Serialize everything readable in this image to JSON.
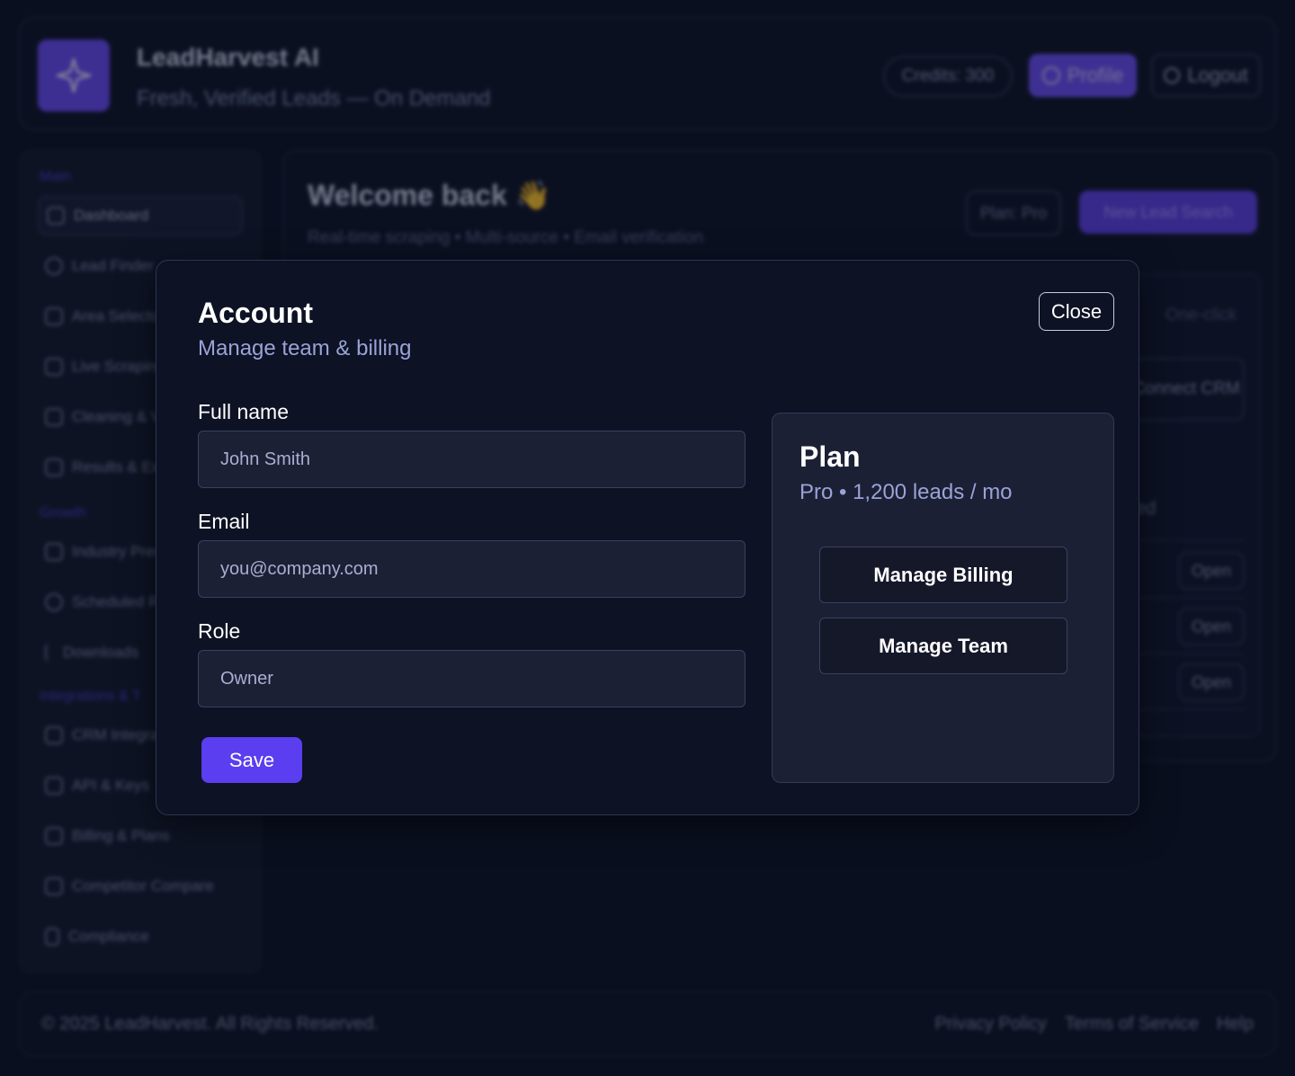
{
  "header": {
    "brand_title": "LeadHarvest AI",
    "brand_subtitle": "Fresh, Verified Leads — On Demand",
    "credits": "Credits: 300",
    "profile_label": "Profile",
    "logout_label": "Logout",
    "logo_icon": "sparkle-icon"
  },
  "sidebar": {
    "sections": [
      "Main",
      "Growth",
      "Integrations & T"
    ],
    "items": [
      {
        "label": "Dashboard",
        "icon": "home-icon"
      },
      {
        "label": "Lead Finder",
        "icon": "search-icon"
      },
      {
        "label": "Area Selector",
        "icon": "map-icon"
      },
      {
        "label": "Live Scraping",
        "icon": "broom-icon"
      },
      {
        "label": "Cleaning & Verification",
        "icon": "calendar-icon"
      },
      {
        "label": "Results & Exports",
        "icon": "file-icon"
      },
      {
        "label": "Industry Presets",
        "icon": "folder-icon"
      },
      {
        "label": "Scheduled Runs",
        "icon": "clock-icon"
      },
      {
        "label": "Downloads",
        "icon": "download-icon"
      },
      {
        "label": "CRM Integrations",
        "icon": "phone-icon"
      },
      {
        "label": "API & Keys",
        "icon": "key-icon"
      },
      {
        "label": "Billing & Plans",
        "icon": "clipboard-icon"
      },
      {
        "label": "Competitor Compare",
        "icon": "chart-icon"
      },
      {
        "label": "Compliance",
        "icon": "shield-icon"
      }
    ]
  },
  "main": {
    "welcome": "Welcome back 👋",
    "welcome_sub": "Real-time scraping • Multi-source • Email verification",
    "plan_pill": "Plan: Pro",
    "new_search": "New Lead Search",
    "one_click": "One-click",
    "connect_crm": "Connect CRM",
    "ed_text": "ed",
    "open_label": "Open"
  },
  "footer": {
    "copyright": "© 2025 LeadHarvest. All Rights Reserved.",
    "links": [
      "Privacy Policy",
      "Terms of Service",
      "Help"
    ]
  },
  "modal": {
    "title": "Account",
    "subtitle": "Manage team & billing",
    "close_label": "Close",
    "fields": {
      "full_name": {
        "label": "Full name",
        "value": "John Smith"
      },
      "email": {
        "label": "Email",
        "placeholder": "you@company.com"
      },
      "role": {
        "label": "Role",
        "value": "Owner"
      }
    },
    "save_label": "Save",
    "plan": {
      "title": "Plan",
      "subtitle": "Pro • 1,200 leads / mo",
      "manage_billing": "Manage Billing",
      "manage_team": "Manage Team"
    }
  },
  "colors": {
    "accent": "#5a3ef0",
    "background": "#0a0f1f",
    "muted_text": "#9aa3d8"
  }
}
